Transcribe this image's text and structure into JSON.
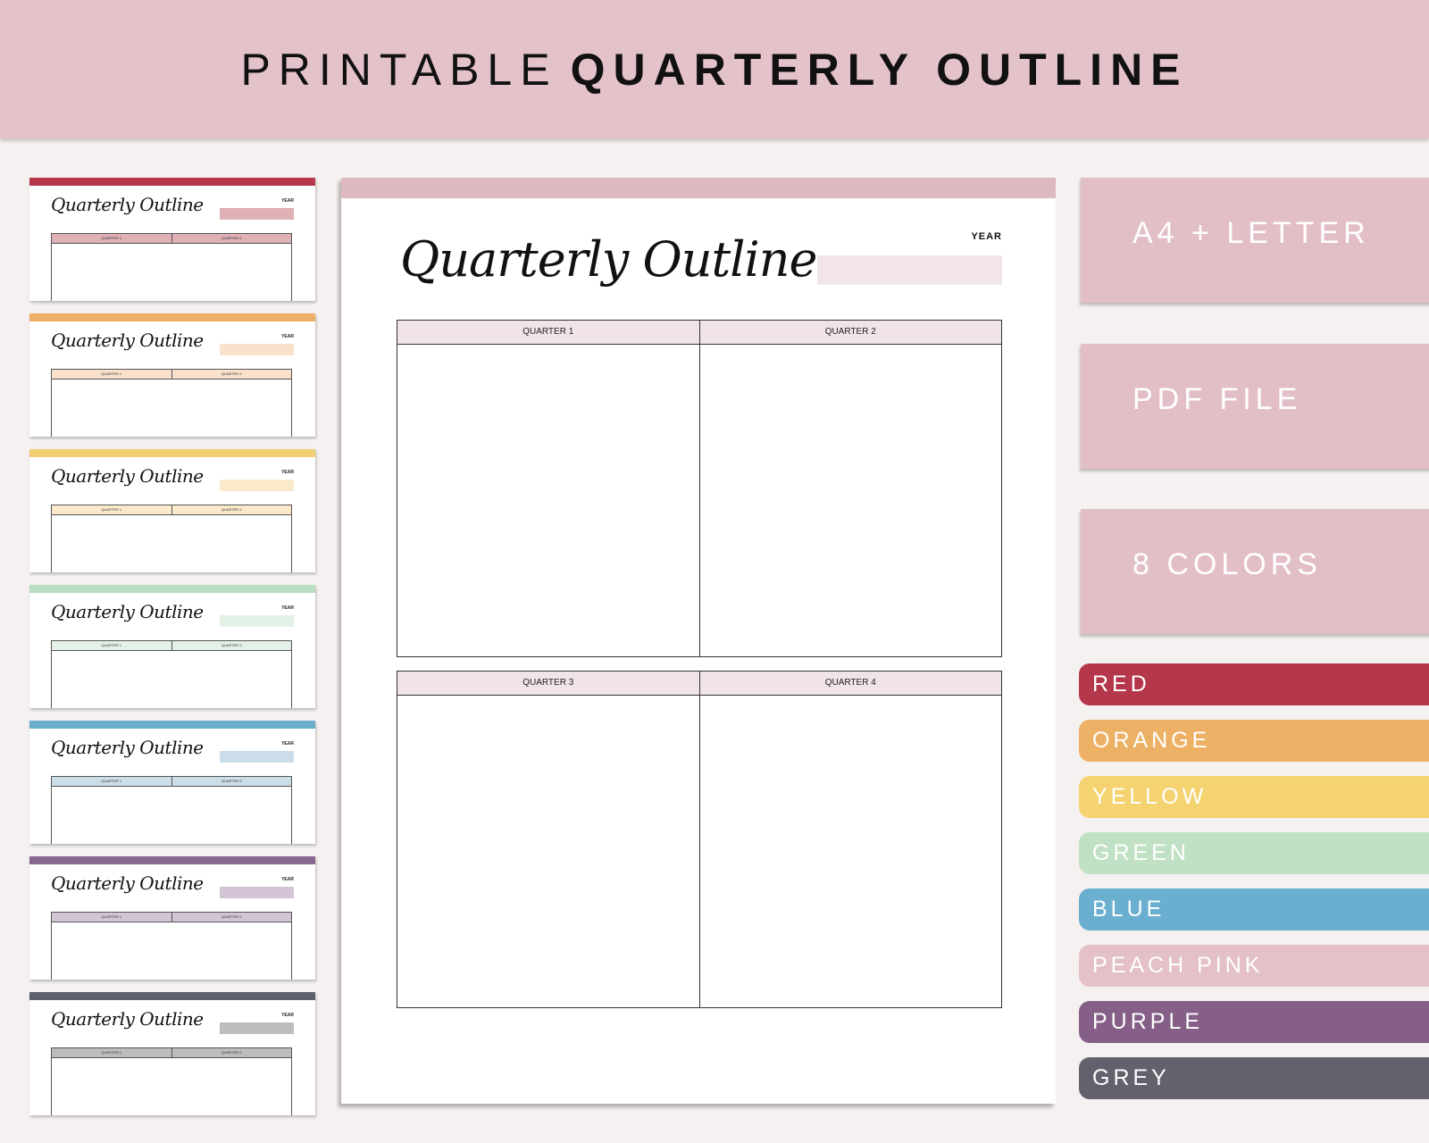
{
  "banner": {
    "title_light": "PRINTABLE",
    "title_bold": "QUARTERLY OUTLINE"
  },
  "template": {
    "script_title": "Quarterly Outline",
    "year_label": "YEAR",
    "quarters": [
      "QUARTER 1",
      "QUARTER 2",
      "QUARTER 3",
      "QUARTER 4"
    ]
  },
  "main_page": {
    "accent_color": "#dcb8c0",
    "fill_color": "#f1e4e6"
  },
  "thumbnails": [
    {
      "name": "red",
      "bar": "#b5394b",
      "fill": "#dfb1b6"
    },
    {
      "name": "orange",
      "bar": "#eeb066",
      "fill": "#f9e1cb"
    },
    {
      "name": "yellow",
      "bar": "#f3cf73",
      "fill": "#faeacb"
    },
    {
      "name": "green",
      "bar": "#b7dfbf",
      "fill": "#e4f1e6"
    },
    {
      "name": "blue",
      "bar": "#6aadcd",
      "fill": "#cbdde9"
    },
    {
      "name": "purple",
      "bar": "#876690",
      "fill": "#d3c5d6"
    },
    {
      "name": "grey",
      "bar": "#5d5f6b",
      "fill": "#bdbdc0"
    }
  ],
  "features": [
    "A4 + LETTER",
    "PDF FILE",
    "8 COLORS"
  ],
  "colors": [
    {
      "label": "RED",
      "hex": "#b5374b"
    },
    {
      "label": "ORANGE",
      "hex": "#edb165"
    },
    {
      "label": "YELLOW",
      "hex": "#f4d370"
    },
    {
      "label": "GREEN",
      "hex": "#c0e1c3"
    },
    {
      "label": "BLUE",
      "hex": "#6aafcf"
    },
    {
      "label": "PEACH PINK",
      "hex": "#e4c0c7"
    },
    {
      "label": "PURPLE",
      "hex": "#855f87"
    },
    {
      "label": "GREY",
      "hex": "#62616c"
    }
  ]
}
